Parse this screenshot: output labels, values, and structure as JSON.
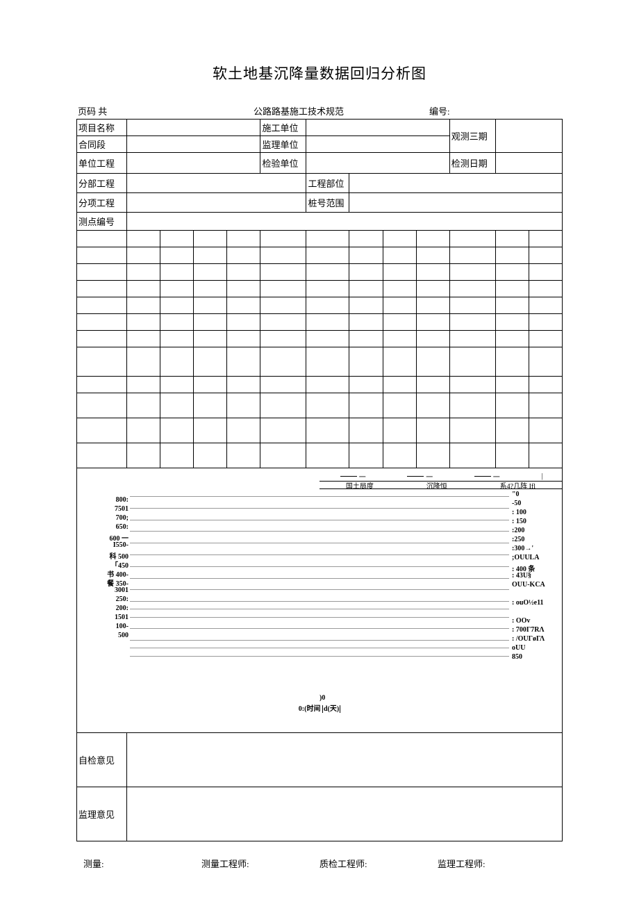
{
  "title": "软土地基沉降量数据回归分析图",
  "header": {
    "pageLabel": "页码 共",
    "spec": "公路路基施工技术规范",
    "numLabel": "编号:"
  },
  "rows": {
    "r1a": "项目名称",
    "r1b": "施工单位",
    "r1c": "观测三期",
    "r2a": "合同段",
    "r2b": "监理单位",
    "r3a": "单位工程",
    "r3b": "检验单位",
    "r3c": "检测日期",
    "r4a": "分部工程",
    "r4b": "工程部位",
    "r5a": "分项工程",
    "r5b": "桩号范围",
    "r6a": "测点编号"
  },
  "legend": {
    "top1": "一",
    "top2": "一",
    "top3": "一",
    "top4": "||",
    "b1": "国土局度",
    "b2": "沉降恒",
    "b3": "系4?几阵 Ifl"
  },
  "chart_data": {
    "type": "line",
    "left_axis_labels": [
      "800:",
      "7501",
      "700;",
      "650:",
      "600 一",
      "I550-",
      "科 500",
      "「450",
      "书 400-",
      "餐 350-",
      "3001",
      "250:",
      "200:",
      "1501",
      "100-",
      "500"
    ],
    "right_axis_labels": [
      "\"0",
      "-50",
      ":  100",
      ":  150",
      ":200",
      ":250",
      ":300→'",
      ";OUULA",
      ":  400 条",
      ":  43U§",
      "OUU-KCA",
      "",
      ":  ouO½e11",
      "",
      ":  OOv",
      ":  700Γ7RΛ",
      ":  /OUΓøΓΛ",
      "oUU",
      "850"
    ],
    "x_center": ")0",
    "x_label": "0:(时间",
    "x_unit": "d(天)"
  },
  "comments": {
    "self": "自检意见",
    "supervise": "监理意见"
  },
  "footer": {
    "f1": "测量:",
    "f2": "测量工程师:",
    "f3": "质检工程师:",
    "f4": "监理工程师:"
  }
}
